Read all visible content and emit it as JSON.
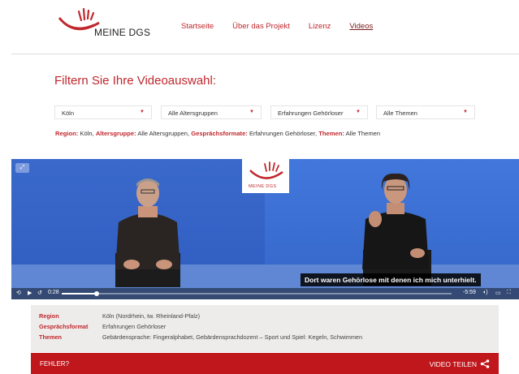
{
  "header": {
    "logo_text": "MEINE DGS",
    "nav": [
      {
        "label": "Startseite"
      },
      {
        "label": "Über das Projekt"
      },
      {
        "label": "Lizenz"
      },
      {
        "label": "Videos"
      }
    ]
  },
  "filter": {
    "title": "Filtern Sie Ihre Videoauswahl:",
    "selects": [
      {
        "value": "Köln"
      },
      {
        "value": "Alle Altersgruppen"
      },
      {
        "value": "Erfahrungen Gehörloser"
      },
      {
        "value": "Alle Themen"
      }
    ],
    "summary": {
      "region_label": "Region:",
      "region_value": "Köln,",
      "age_label": "Altersgruppe:",
      "age_value": "Alle Altersgruppen,",
      "format_label": "Gesprächsformate:",
      "format_value": "Erfahrungen Gehörloser,",
      "themes_label": "Themen:",
      "themes_value": "Alle Themen"
    }
  },
  "video": {
    "logo_text": "MEINE DGS",
    "subtitle": "Dort waren Gehörlose mit denen ich mich unterhielt.",
    "current_time": "0:28",
    "remaining_time": "-5:59",
    "progress": 0.09
  },
  "info": {
    "rows": [
      {
        "key": "Region",
        "value": "Köln (Nordrhein, tw. Rheinland-Pfalz)"
      },
      {
        "key": "Gesprächsformat",
        "value": "Erfahrungen Gehörloser"
      },
      {
        "key": "Themen",
        "value": "Gebärdensprache: Fingeralphabet, Gebärdensprachdozent – Sport und Spiel: Kegeln, Schwimmen"
      }
    ]
  },
  "footer": {
    "error_label": "FEHLER?",
    "share_label": "VIDEO TEILEN"
  },
  "colors": {
    "brand_red": "#c0272d",
    "bar_red": "#c0171d",
    "video_blue": "#3d6fd1"
  },
  "icons": [
    "logo-mark-icon",
    "caret-down-icon",
    "expand-icon",
    "rewind-icon",
    "play-icon",
    "replay-icon",
    "audio-description-icon",
    "subtitles-icon",
    "fullscreen-icon",
    "share-icon"
  ]
}
